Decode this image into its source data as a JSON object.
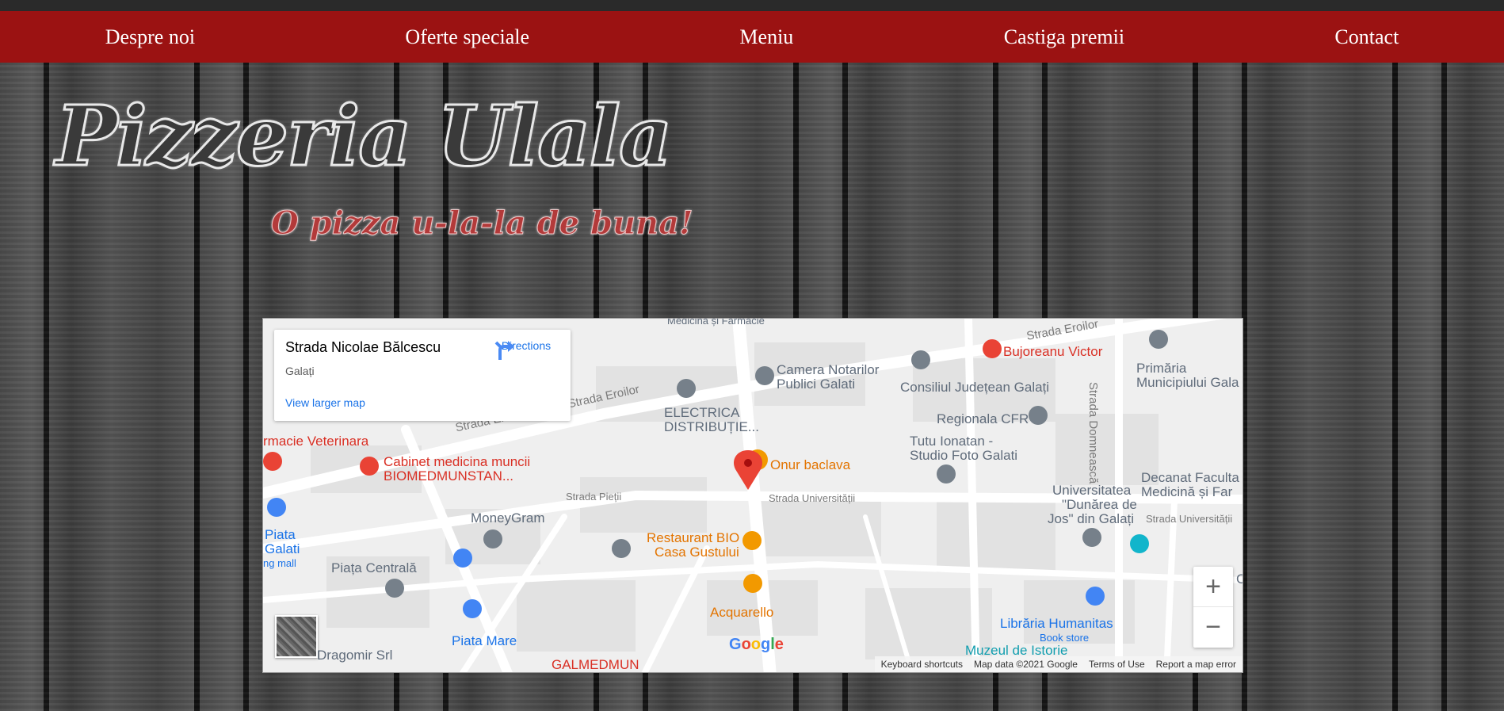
{
  "nav": {
    "items": [
      "Despre noi",
      "Oferte speciale",
      "Meniu",
      "Castiga premii",
      "Contact"
    ]
  },
  "brand": {
    "logo": "Pizzeria Ulala",
    "tagline": "O pizza u-la-la de buna!"
  },
  "colors": {
    "nav_bg": "#9b1212",
    "map_link": "#1a73e8"
  },
  "map": {
    "card": {
      "title": "Strada Nicolae Bălcescu",
      "subtitle": "Galați",
      "directions": "Directions",
      "larger_map": "View larger map"
    },
    "labels": {
      "medicina": "Medicina și Farmacie",
      "strada_eroilor_top": "Strada Eroilor",
      "bujoreanu": "Bujoreanu Victor",
      "strada_domneasca": "Strada Domnească",
      "primaria_1": "Primăria",
      "primaria_2": "Municipiului Gala",
      "camera_1": "Camera Notarilor",
      "camera_2": "Publici Galati",
      "consiliul": "Consiliul Județean Galați",
      "strada_eroilor_mid": "Strada Eroilor",
      "strada_eroilor_left": "Strada Eroilor",
      "electrica_1": "ELECTRICA",
      "electrica_2": "DISTRIBUȚIE...",
      "regionala": "Regionala CFR",
      "tutu_1": "Tutu Ionatan -",
      "tutu_2": "Studio Foto Galati",
      "farmacie": "rmacie Veterinara",
      "cabinet_1": "Cabinet medicina muncii",
      "cabinet_2": "BIOMEDMUNSTAN...",
      "onur": "Onur baclava",
      "decanat_1": "Decanat Faculta",
      "decanat_2": "Medicină și Far",
      "univ_1": "Universitatea",
      "univ_2": "\"Dunărea de",
      "univ_3": "Jos\" din Galați",
      "strada_pietii": "Strada Pieții",
      "strada_univ": "Strada Universității",
      "strada_univ_right": "Strada Universității",
      "piata_galati_1": "Piata",
      "piata_galati_2": "Galati",
      "piata_galati_3": "ng mall",
      "moneygram": "MoneyGram",
      "restaurant_1": "Restaurant BIO",
      "restaurant_2": "Casa Gustului",
      "piata_centrala": "Piața Centrală",
      "acquarello": "Acquarello",
      "piata_mare": "Piata Mare",
      "libraria": "Librăria Humanitas",
      "book_store": "Book store",
      "muzeul": "Muzeul de Istorie",
      "dragomir": "Dragomir Srl",
      "galmedmun": "GALMEDMUN",
      "right_c": "C"
    },
    "zoom_in": "+",
    "zoom_out": "−",
    "google": "Google",
    "footer": {
      "shortcuts": "Keyboard shortcuts",
      "data": "Map data ©2021 Google",
      "terms": "Terms of Use",
      "report": "Report a map error"
    }
  }
}
